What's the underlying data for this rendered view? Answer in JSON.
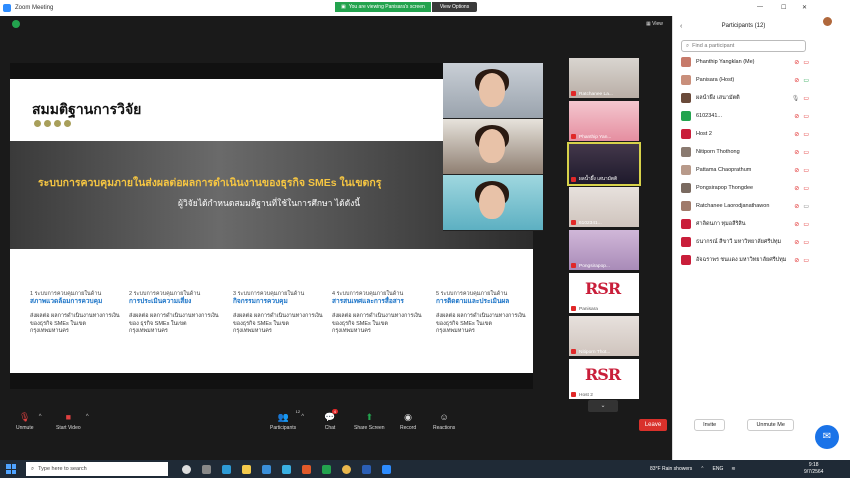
{
  "window": {
    "title": "Zoom Meeting"
  },
  "banner": {
    "viewing": "You are viewing Panisara's screen",
    "options": "View Options"
  },
  "view_label": "View",
  "slide": {
    "title": "สมมติฐานการวิจัย",
    "banner_line1": "ระบบการควบคุมภายในส่งผลต่อผลการดำเนินงานของธุรกิจ SMEs ในเขตกรุ",
    "banner_line2": "ผู้วิจัยได้กำหนดสมมติฐานที่ใช้ในการศึกษา ได้ดังนี้",
    "columns": [
      {
        "head": "1 ระบบการควบคุมภายในด้าน",
        "focus": "สภาพแวดล้อมการควบคุม",
        "body": "ส่งผลต่อ ผลการดำเนินงานทางการเงิน ของธุรกิจ SMEs ในเขต กรุงเทพมหานคร"
      },
      {
        "head": "2 ระบบการควบคุมภายในด้าน",
        "focus": "การประเมินความเสี่ยง",
        "body": "ส่งผลต่อ ผลการดำเนินงานทางการเงินของ ธุรกิจ SMEs ในเขต กรุงเทพมหานคร"
      },
      {
        "head": "3 ระบบการควบคุมภายในด้าน",
        "focus": "กิจกรรมการควบคุม",
        "body": "ส่งผลต่อ ผลการดำเนินงานทางการเงิน ของธุรกิจ SMEs ในเขต กรุงเทพมหานคร"
      },
      {
        "head": "4 ระบบการควบคุมภายในด้าน",
        "focus": "สารสนเทศและการสื่อสาร",
        "body": "ส่งผลต่อ ผลการดำเนินงานทางการเงิน ของธุรกิจ SMEs ในเขต กรุงเทพมหานคร"
      },
      {
        "head": "5 ระบบการควบคุมภายในด้าน",
        "focus": "การติดตามและประเมินผล",
        "body": "ส่งผลต่อ ผลการดำเนินงานทางการเงิน ของธุรกิจ SMEs ในเขต กรุงเทพมหานคร"
      }
    ]
  },
  "video_tiles": [
    {
      "name": "Ratchanee La..."
    },
    {
      "name": "Phanthip Yan..."
    },
    {
      "name": "ผลน้ำผึ้ง เสนามัตติ"
    },
    {
      "name": "6102341..."
    },
    {
      "name": "Pongsirapop..."
    },
    {
      "name": "Panisara"
    },
    {
      "name": "Nitiporn Thot..."
    },
    {
      "name": "Host 2"
    }
  ],
  "toolbar": {
    "unmute": "Unmute",
    "start_video": "Start Video",
    "participants": "Participants",
    "participants_count": "12",
    "chat": "Chat",
    "chat_badge": "4",
    "share_screen": "Share Screen",
    "record": "Record",
    "reactions": "Reactions",
    "leave": "Leave"
  },
  "panel": {
    "title": "Participants (12)",
    "search_placeholder": "Find a participant",
    "participants": [
      {
        "name": "Phanthip Yangklan (Me)",
        "color": "#c77a6a"
      },
      {
        "name": "Panisara (Host)",
        "color": "#c98f7b"
      },
      {
        "name": "ผลน้ำผึ้ง เสนามัตติ",
        "color": "#6a4a3a"
      },
      {
        "name": "6102341...",
        "color": "#23a34e"
      },
      {
        "name": "Host 2",
        "color": "#c91e3a"
      },
      {
        "name": "Nitiporn Thothong",
        "color": "#8a7a70"
      },
      {
        "name": "Pattama Chaoprathum",
        "color": "#b89a8a"
      },
      {
        "name": "Pongsirapop Thongdee",
        "color": "#7a6a60"
      },
      {
        "name": "Ratchanee Laorodjanathawon",
        "color": "#a07a6a"
      },
      {
        "name": "ศาลิดนภา ทุมอลีริสิน",
        "color": "#c91e3a"
      },
      {
        "name": "ธนากรณ์ สีขาวี มหาวิทยาลัยศรีปทุม",
        "color": "#c91e3a"
      },
      {
        "name": "อัจฉราพร ชนแดง มหาวิทยาลัยศรีปทุม",
        "color": "#c91e3a"
      }
    ],
    "invite": "Invite",
    "unmute_me": "Unmute Me"
  },
  "taskbar": {
    "search_placeholder": "Type here to search",
    "weather": "83°F  Rain showers",
    "lang": "ENG",
    "time": "9:18",
    "date": "9/7/2564"
  }
}
